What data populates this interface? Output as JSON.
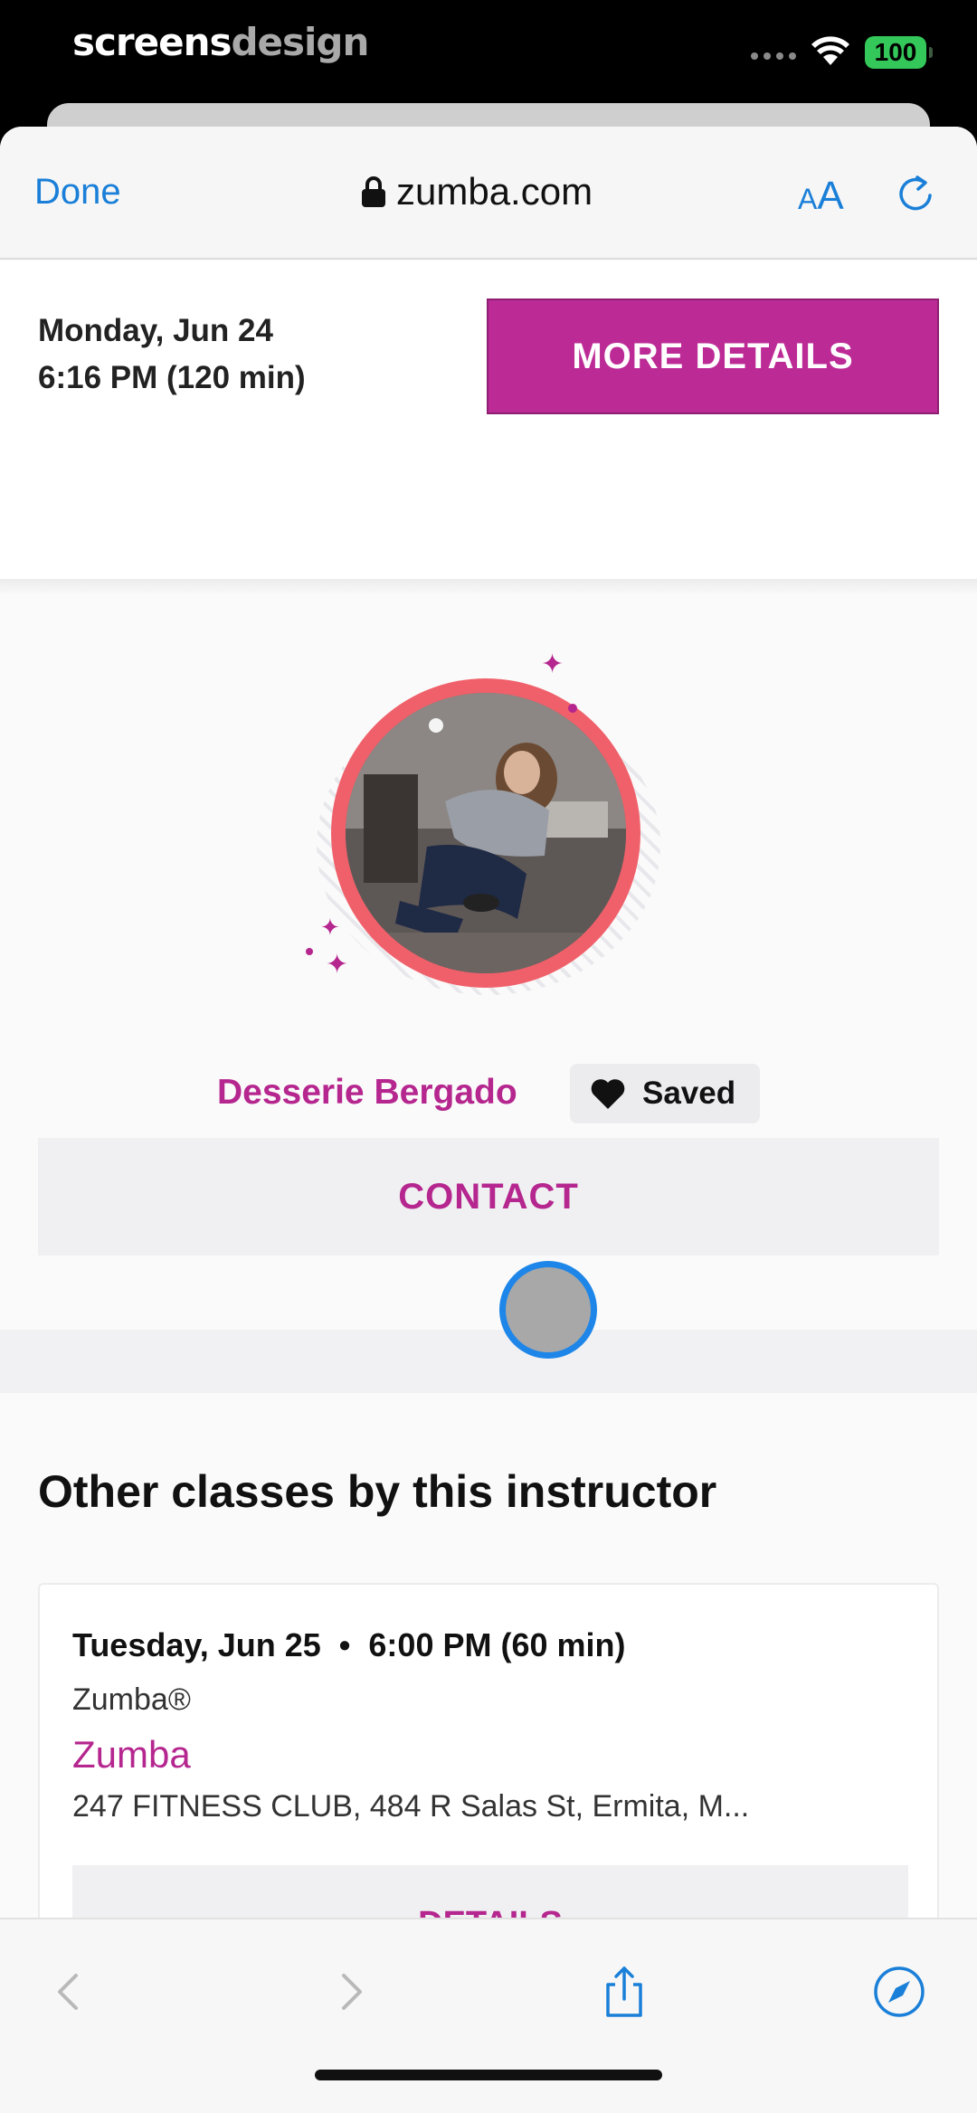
{
  "status_bar": {
    "brand_a": "screens",
    "brand_b": "design",
    "battery": "100"
  },
  "safari": {
    "done_label": "Done",
    "url": "zumba.com",
    "text_size_small": "A",
    "text_size_large": "A"
  },
  "class_header": {
    "date": "Monday, Jun 24",
    "time": "6:16 PM (120 min)",
    "more_details_label": "MORE DETAILS"
  },
  "instructor": {
    "name": "Desserie Bergado",
    "saved_label": "Saved",
    "contact_label": "CONTACT"
  },
  "other_classes": {
    "title": "Other classes by this instructor",
    "items": [
      {
        "date": "Tuesday, Jun 25",
        "separator": "•",
        "time": "6:00 PM (60 min)",
        "style": "Zumba®",
        "name": "Zumba",
        "location": "247 FITNESS CLUB, 484 R Salas St, Ermita, M...",
        "details_label": "DETAILS"
      }
    ]
  },
  "colors": {
    "accent": "#bc2a96",
    "link": "#1a7fd8",
    "avatar_ring": "#f0606a"
  }
}
